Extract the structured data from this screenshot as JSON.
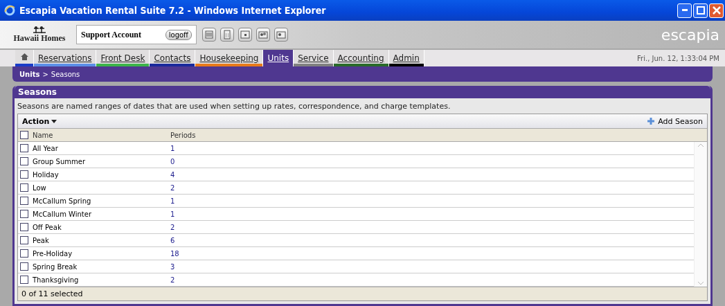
{
  "window": {
    "title": "Escapia Vacation Rental Suite 7.2 - Windows Internet Explorer"
  },
  "header": {
    "company": "Hawaii Homes",
    "account": "Support Account",
    "logoff": "logoff",
    "brand": "escapia"
  },
  "tabs": [
    {
      "kind": "home",
      "color": "#1a3cc8",
      "selected": false
    },
    {
      "kind": "text",
      "label": "Reservations",
      "color": "#5b8fe8",
      "selected": false
    },
    {
      "kind": "text",
      "label": "Front Desk",
      "color": "#3cb44a",
      "selected": false
    },
    {
      "kind": "text",
      "label": "Contacts",
      "color": "#1a2a9c",
      "selected": false
    },
    {
      "kind": "text",
      "label": "Housekeeping",
      "color": "#e87a1a",
      "selected": false
    },
    {
      "kind": "text",
      "label": "Units",
      "color": "#4f3790",
      "selected": true
    },
    {
      "kind": "text",
      "label": "Service",
      "color": "#808080",
      "selected": false
    },
    {
      "kind": "text",
      "label": "Accounting",
      "color": "#2a6a2a",
      "selected": false
    },
    {
      "kind": "text",
      "label": "Admin",
      "color": "#000000",
      "selected": false
    }
  ],
  "datetime": "Fri., Jun. 12, 1:33:04 PM",
  "breadcrumb": {
    "parent": "Units",
    "separator": ">",
    "current": "Seasons"
  },
  "panel": {
    "title": "Seasons",
    "description": "Seasons are named ranges of dates that are used when setting up rates, correspondence, and charge templates.",
    "action": "Action",
    "add": "Add Season"
  },
  "table": {
    "columns": [
      "Name",
      "Periods"
    ],
    "header_checked": false,
    "rows": [
      {
        "name": "All Year",
        "periods": "1",
        "checked": false
      },
      {
        "name": "Group Summer",
        "periods": "0",
        "checked": false
      },
      {
        "name": "Holiday",
        "periods": "4",
        "checked": false
      },
      {
        "name": "Low",
        "periods": "2",
        "checked": false
      },
      {
        "name": "McCallum Spring",
        "periods": "1",
        "checked": false
      },
      {
        "name": "McCallum Winter",
        "periods": "1",
        "checked": false
      },
      {
        "name": "Off Peak",
        "periods": "2",
        "checked": false
      },
      {
        "name": "Peak",
        "periods": "6",
        "checked": false
      },
      {
        "name": "Pre-Holiday",
        "periods": "18",
        "checked": false
      },
      {
        "name": "Spring Break",
        "periods": "3",
        "checked": false
      },
      {
        "name": "Thanksgiving",
        "periods": "2",
        "checked": false
      }
    ]
  },
  "status": "0 of 11 selected"
}
